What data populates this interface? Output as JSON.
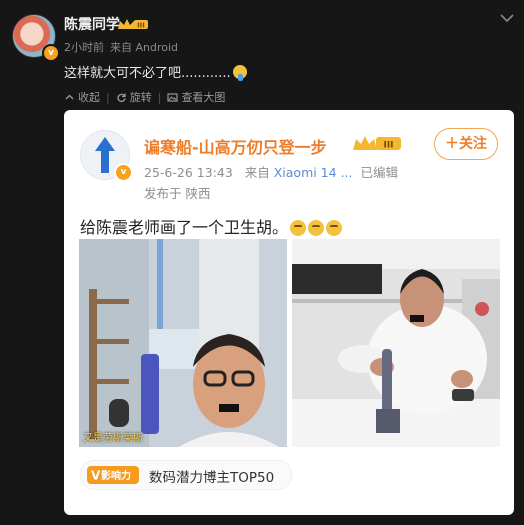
{
  "post": {
    "username": "陈震同学",
    "time": "2小时前",
    "source": "来自 Android",
    "text": "这样就大可不必了吧............",
    "actions": [
      {
        "label": "收起",
        "icon": "collapse-icon"
      },
      {
        "label": "旋转",
        "icon": "rotate-icon"
      },
      {
        "label": "查看大图",
        "icon": "image-view-icon"
      }
    ],
    "member_badge": "III"
  },
  "repost": {
    "username": "谝寒船-山高万仞只登一步",
    "member_badge": "III",
    "follow_label": "关注",
    "date": "25-6-26 13:43",
    "source_prefix": "来自",
    "source": "Xiaomi 14 ...",
    "edited": "已编辑",
    "location": "发布于 陕西",
    "text": "给陈震老师画了一个卫生胡。",
    "image_caption": "又是劳斯莱斯",
    "influence_logo": "影响力",
    "influence_text": "数码潜力博主TOP50"
  },
  "colors": {
    "background": "#161616",
    "card": "#ffffff",
    "accent_orange": "#ef7d28",
    "link_blue": "#5b8dd6",
    "muted": "#8a8a8a"
  }
}
